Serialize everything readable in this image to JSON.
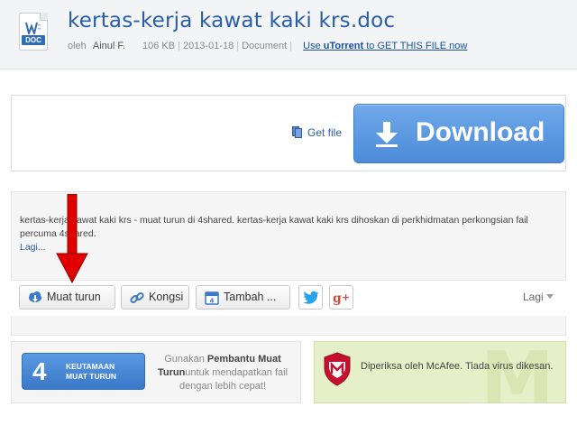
{
  "header": {
    "file_type_tag": "DOC",
    "title": "kertas-kerja kawat kaki krs.doc",
    "by_label": "oleh",
    "author": "Ainul F.",
    "size": "106 KB",
    "date": "2013-01-18",
    "category": "Document",
    "utorrent_link_prefix": "Use ",
    "utorrent_brand": "uTorrent",
    "utorrent_link_suffix": " to GET THIS FILE now"
  },
  "download": {
    "get_file_label": "Get file",
    "button_label": "Download"
  },
  "description": {
    "text": "kertas-kerja kawat kaki krs - muat turun di 4shared. kertas-kerja kawat kaki krs dihoskan di perkhidmatan perkongsian fail percuma 4shared.",
    "more_link": "Lagi..."
  },
  "toolbar": {
    "download_label": "Muat turun",
    "share_label": "Kongsi",
    "add_label": "Tambah ...",
    "more_label": "Lagi"
  },
  "promo": {
    "number": "4",
    "button_line1": "KEUTAMAAN",
    "button_line2": "MUAT TURUN",
    "text_prefix": "Gunakan ",
    "text_bold": "Pembantu Muat Turun",
    "text_suffix": "untuk mendapatkan fail dengan lebih cepat!"
  },
  "mcafee": {
    "watermark": "M",
    "text": "Diperiksa oleh McAfee. Tiada virus dikesan."
  },
  "colors": {
    "link_blue": "#2a5da8",
    "download_blue": "#4d8bd8",
    "arrow_red": "#e00000",
    "mcafee_bg": "#e6f0c8"
  }
}
